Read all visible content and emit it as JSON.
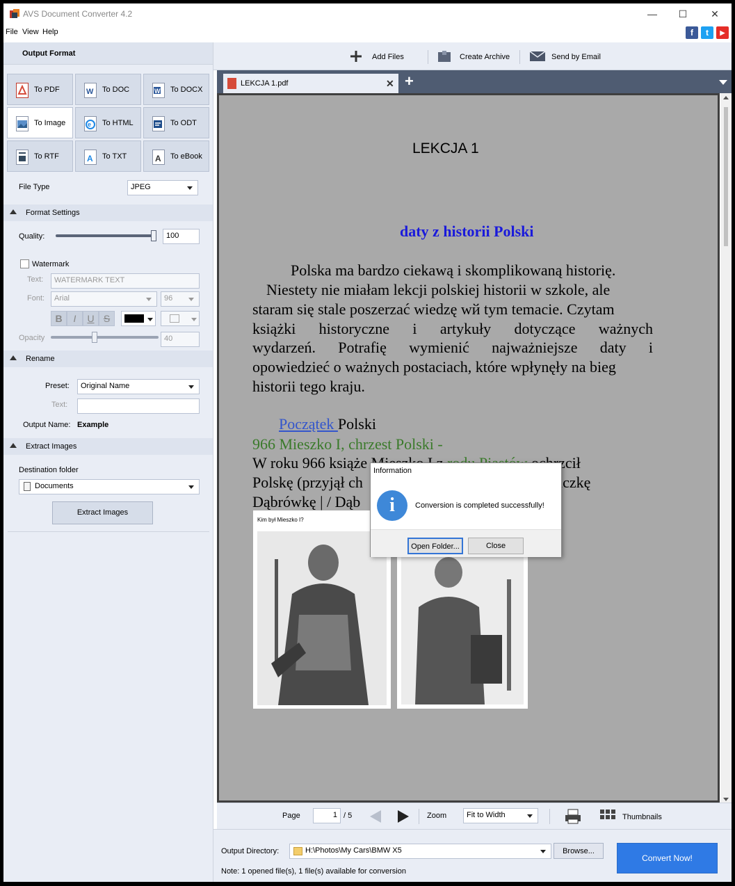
{
  "window": {
    "title": "AVS Document Converter 4.2"
  },
  "menu": [
    "File",
    "View",
    "Help"
  ],
  "social": [
    "f",
    "t",
    "▶"
  ],
  "left": {
    "header": "Output Format",
    "formats": [
      "To PDF",
      "To DOC",
      "To DOCX",
      "To Image",
      "To HTML",
      "To ODT",
      "To RTF",
      "To TXT",
      "To eBook"
    ],
    "file_type_label": "File Type",
    "file_type_value": "JPEG",
    "format_settings": {
      "title": "Format Settings",
      "quality_label": "Quality:",
      "quality_value": "100",
      "quality_level": 1.0,
      "watermark_label": "Watermark",
      "text_label": "Text:",
      "text_placeholder": "WATERMARK TEXT",
      "font_label": "Font:",
      "font_value": "Arial",
      "font_size": "96",
      "bold": "B",
      "italic": "I",
      "underline": "U",
      "strike": "S",
      "opacity_label": "Opacity",
      "opacity_value": "40",
      "opacity_level": 0.4
    },
    "rename": {
      "title": "Rename",
      "preset_label": "Preset:",
      "preset_value": "Original Name",
      "text_label": "Text:",
      "output_name_label": "Output Name:",
      "output_name_value": "Example"
    },
    "extract": {
      "title": "Extract Images",
      "dest_label": "Destination folder",
      "dest_value": "Documents",
      "button": "Extract Images"
    }
  },
  "toolbar": {
    "add_files": "Add Files",
    "create_archive": "Create Archive",
    "send_email": "Send by Email"
  },
  "tab": {
    "name": "LEKCJA 1.pdf",
    "close": "✕",
    "add": "+"
  },
  "document": {
    "heading": "LEKCJA  1",
    "subheading": "daty z historii Polski",
    "lines": [
      "Polska ma bardzo ciekawą i skomplikowaną historię.",
      "Niestety nie miałam lekcji polskiej historii w szkole, ale",
      "staram się stale poszerzać wiedzę wй tym temacie. Czytam",
      "książki historyczne i artykuły dotyczące ważnych",
      "wydarzeń. Potrafię wymienić najważniejsze daty i",
      "opowiedzieć o ważnych postaciach, które wpłynęły na bieg",
      "historii  tego kraju."
    ],
    "link_word": "Początek ",
    "link_rest": "Polski",
    "green_line": "966 Mieszko I, chrzest Polski   -",
    "line_a1": "W roku 966 książe Mieszko I  z ",
    "line_a_green": "rodu Piastów",
    "line_a2": " ochrzcił",
    "line_b1": "Polskę (przyjął ch",
    "line_b2": "niczkę",
    "line_c": "Dąbrówkę | / Dąb",
    "image_caption": "Kim był Mieszko I?"
  },
  "dialog": {
    "title": "Information",
    "message": "Conversion is completed successfully!",
    "open_folder": "Open Folder...",
    "close": "Close"
  },
  "pagebar": {
    "page_label": "Page",
    "page_current": "1",
    "page_total": "/ 5",
    "zoom_label": "Zoom",
    "zoom_value": "Fit to Width",
    "thumbnails": "Thumbnails"
  },
  "output": {
    "dir_label": "Output Directory:",
    "dir_value": "H:\\Photos\\My Cars\\BMW X5",
    "browse": "Browse...",
    "convert": "Convert Now!",
    "note": "Note: 1 opened file(s), 1 file(s) available for conversion"
  }
}
